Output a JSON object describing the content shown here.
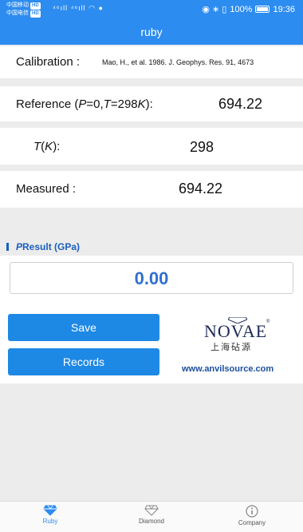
{
  "status": {
    "carrier1": "中国移动",
    "carrier1_badge": "HD",
    "carrier2": "中国电信",
    "carrier2_badge": "HD",
    "signal_text": "⁴⁶ıll ⁴⁶ıll ◠ ●",
    "right_icons": "◉ ∗ ▯",
    "battery": "100%",
    "time": "19:36"
  },
  "app": {
    "title": "ruby"
  },
  "calibration": {
    "label": "Calibration :",
    "value": "Mao, H., et al. 1986. J. Geophys. Res. 91, 4673"
  },
  "reference": {
    "label_prefix": "Reference (",
    "label_p": "P",
    "label_mid": "=0,",
    "label_t": "T",
    "label_suffix": "=298",
    "label_k": "K",
    "label_end": "):",
    "value": "694.22"
  },
  "temperature": {
    "label_t": "T",
    "label_open": "(",
    "label_k": "K",
    "label_close": "):",
    "value": "298"
  },
  "measured": {
    "label": "Measured :",
    "value": "694.22"
  },
  "result": {
    "label_p": "P",
    "label_rest": " Result (GPa)",
    "value": "0.00"
  },
  "buttons": {
    "save": "Save",
    "records": "Records"
  },
  "brand": {
    "logo_text": "NOVAE",
    "logo_reg": "®",
    "chinese": "上海砧源",
    "website": "www.anvilsource.com"
  },
  "nav": [
    {
      "label": "Ruby",
      "icon": "diamond-icon",
      "active": true
    },
    {
      "label": "Diamond",
      "icon": "diamond-outline-icon",
      "active": false
    },
    {
      "label": "Company",
      "icon": "info-icon",
      "active": false
    }
  ],
  "colors": {
    "accent": "#2d8cf0",
    "button": "#1e88e5",
    "result": "#2f6fd0",
    "brand": "#1c4fa0"
  }
}
